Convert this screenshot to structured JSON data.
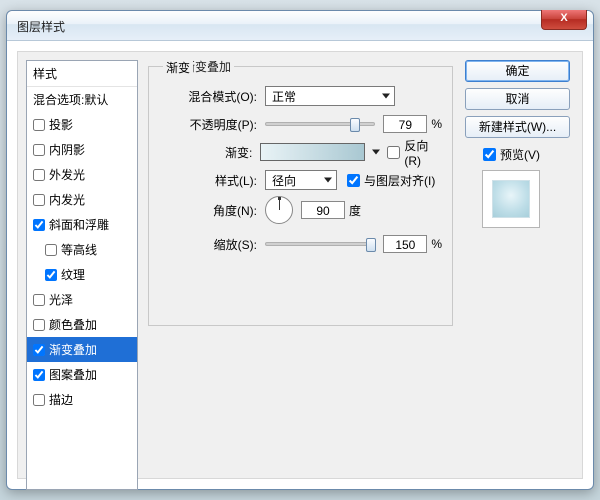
{
  "window": {
    "title": "图层样式"
  },
  "close_x": "X",
  "styles": {
    "header": "样式",
    "blend_defaults": "混合选项:默认",
    "items": [
      "投影",
      "内阴影",
      "外发光",
      "内发光",
      "斜面和浮雕",
      "等高线",
      "纹理",
      "光泽",
      "颜色叠加",
      "渐变叠加",
      "图案叠加",
      "描边"
    ]
  },
  "panel": {
    "title": "渐变叠加",
    "frame_title": "渐变",
    "blend_mode_label": "混合模式(O):",
    "blend_mode_value": "正常",
    "opacity_label": "不透明度(P):",
    "opacity_value": "79",
    "percent": "%",
    "gradient_label": "渐变:",
    "reverse": "反向(R)",
    "style_label": "样式(L):",
    "style_value": "径向",
    "align": "与图层对齐(I)",
    "angle_label": "角度(N):",
    "angle_value": "90",
    "degree": "度",
    "scale_label": "缩放(S):",
    "scale_value": "150"
  },
  "buttons": {
    "ok": "确定",
    "cancel": "取消",
    "new_style": "新建样式(W)...",
    "preview": "预览(V)"
  }
}
